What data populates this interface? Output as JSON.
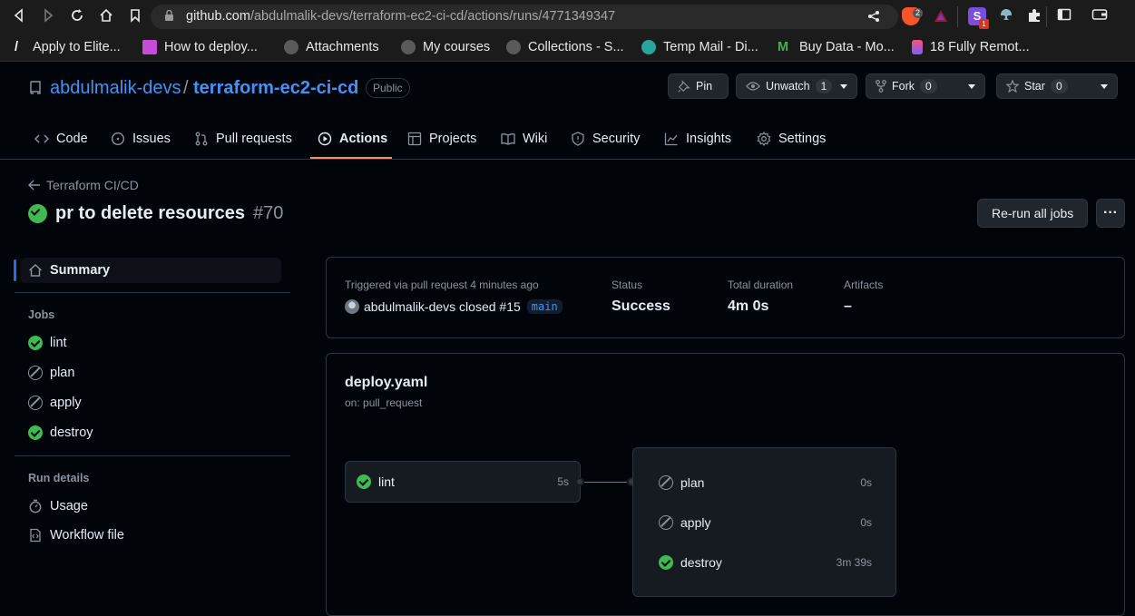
{
  "browser": {
    "url_host": "github.com",
    "url_path": "/abdulmalik-devs/terraform-ec2-ci-cd/actions/runs/4771349347",
    "brave_badge": "2",
    "ext_badge": "1",
    "bookmarks": [
      "Apply to Elite...",
      "How to deploy...",
      "Attachments",
      "My courses",
      "Collections - S...",
      "Temp Mail - Di...",
      "Buy Data - Mo...",
      "18 Fully Remot..."
    ]
  },
  "repo": {
    "owner": "abdulmalik-devs",
    "separator": "/",
    "name": "terraform-ec2-ci-cd",
    "visibility": "Public",
    "pin_label": "Pin",
    "unwatch_label": "Unwatch",
    "unwatch_count": "1",
    "fork_label": "Fork",
    "fork_count": "0",
    "star_label": "Star",
    "star_count": "0"
  },
  "tabs": [
    "Code",
    "Issues",
    "Pull requests",
    "Actions",
    "Projects",
    "Wiki",
    "Security",
    "Insights",
    "Settings"
  ],
  "run": {
    "back_label": "Terraform CI/CD",
    "title": "pr to delete resources",
    "number": "#70",
    "rerun_label": "Re-run all jobs",
    "more_label": "···"
  },
  "sidebar": {
    "summary_label": "Summary",
    "jobs_heading": "Jobs",
    "jobs": [
      {
        "name": "lint",
        "status": "success"
      },
      {
        "name": "plan",
        "status": "skipped"
      },
      {
        "name": "apply",
        "status": "skipped"
      },
      {
        "name": "destroy",
        "status": "success"
      }
    ],
    "run_details_heading": "Run details",
    "usage_label": "Usage",
    "workflow_file_label": "Workflow file"
  },
  "summary": {
    "trigger_label": "Triggered via pull request 4 minutes ago",
    "actor": "abdulmalik-devs closed #15",
    "branch": "main",
    "status_label": "Status",
    "status_value": "Success",
    "duration_label": "Total duration",
    "duration_value": "4m 0s",
    "artifacts_label": "Artifacts",
    "artifacts_value": "–"
  },
  "workflow": {
    "file": "deploy.yaml",
    "trigger": "on: pull_request",
    "lint": {
      "name": "lint",
      "duration": "5s"
    },
    "group": [
      {
        "name": "plan",
        "duration": "0s",
        "status": "skipped"
      },
      {
        "name": "apply",
        "duration": "0s",
        "status": "skipped"
      },
      {
        "name": "destroy",
        "duration": "3m 39s",
        "status": "success"
      }
    ]
  },
  "colors": {
    "success": "#3fb950",
    "accent_tab": "#fd8c73",
    "link": "#4493f8",
    "bg": "#010409"
  }
}
